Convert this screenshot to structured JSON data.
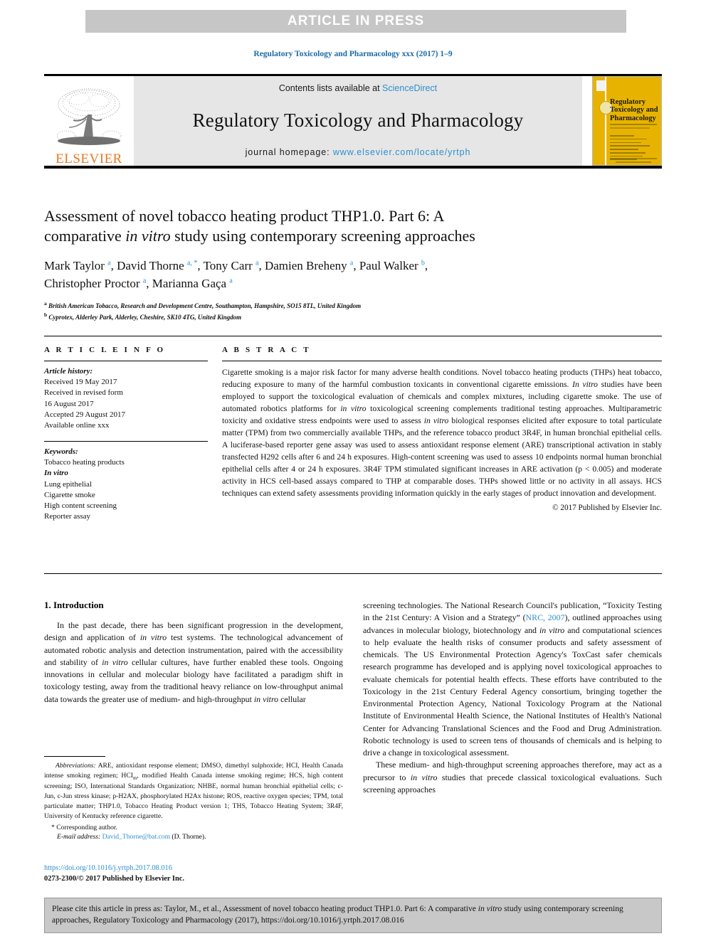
{
  "banner": {
    "text": "ARTICLE IN PRESS",
    "band_color": "#c6c6c6"
  },
  "running_head": "Regulatory Toxicology and Pharmacology xxx (2017) 1–9",
  "masthead": {
    "contents_prefix": "Contents lists available at ",
    "sciencedirect": "ScienceDirect",
    "journal_title": "Regulatory Toxicology and Pharmacology",
    "homepage_label": "journal homepage: ",
    "homepage_url": "www.elsevier.com/locate/yrtph",
    "publisher_wordmark": "ELSEVIER",
    "publisher_color": "#e87722",
    "link_color": "#2e8ece",
    "cover": {
      "title": "Regulatory Toxicology and Pharmacology",
      "background_color": "#e8b300"
    }
  },
  "article": {
    "title_line1": "Assessment of novel tobacco heating product THP1.0. Part 6: A",
    "title_line2_pre": "comparative ",
    "title_line2_em": "in vitro",
    "title_line2_post": " study using contemporary screening approaches",
    "authors": [
      {
        "name": "Mark Taylor",
        "marks": "a"
      },
      {
        "name": "David Thorne",
        "marks": "a, *"
      },
      {
        "name": "Tony Carr",
        "marks": "a"
      },
      {
        "name": "Damien Breheny",
        "marks": "a"
      },
      {
        "name": "Paul Walker",
        "marks": "b"
      },
      {
        "name": "Christopher Proctor",
        "marks": "a"
      },
      {
        "name": "Marianna Gaça",
        "marks": "a"
      }
    ],
    "affiliations": [
      {
        "mark": "a",
        "text": "British American Tobacco, Research and Development Centre, Southampton, Hampshire, SO15 8TL, United Kingdom"
      },
      {
        "mark": "b",
        "text": "Cyprotex, Alderley Park, Alderley, Cheshire, SK10 4TG, United Kingdom"
      }
    ]
  },
  "article_info": {
    "heading": "A R T I C L E   I N F O",
    "history_label": "Article history:",
    "history_lines": [
      "Received 19 May 2017",
      "Received in revised form",
      "16 August 2017",
      "Accepted 29 August 2017",
      "Available online xxx"
    ],
    "keywords_label": "Keywords:",
    "keywords": [
      "Tobacco heating products",
      "In vitro",
      "Lung epithelial",
      "Cigarette smoke",
      "High content screening",
      "Reporter assay"
    ],
    "keywords_italic_index": 1
  },
  "abstract": {
    "heading": "A B S T R A C T",
    "parts": [
      {
        "t": "Cigarette smoking is a major risk factor for many adverse health conditions. Novel tobacco heating products (THPs) heat tobacco, reducing exposure to many of the harmful combustion toxicants in conventional cigarette emissions. "
      },
      {
        "t": "In vitro",
        "em": true
      },
      {
        "t": " studies have been employed to support the toxicological evaluation of chemicals and complex mixtures, including cigarette smoke. The use of automated robotics platforms for "
      },
      {
        "t": "in vitro",
        "em": true
      },
      {
        "t": " toxicological screening complements traditional testing approaches. Multiparametric toxicity and oxidative stress endpoints were used to assess "
      },
      {
        "t": "in vitro",
        "em": true
      },
      {
        "t": " biological responses elicited after exposure to total particulate matter (TPM) from two commercially available THPs, and the reference tobacco product 3R4F, in human bronchial epithelial cells. A luciferase-based reporter gene assay was used to assess antioxidant response element (ARE) transcriptional activation in stably transfected H292 cells after 6 and 24 h exposures. High-content screening was used to assess 10 endpoints normal human bronchial epithelial cells after 4 or 24 h exposures. 3R4F TPM stimulated significant increases in ARE activation (p < 0.005) and moderate activity in HCS cell-based assays compared to THP at comparable doses. THPs showed little or no activity in all assays. HCS techniques can extend safety assessments providing information quickly in the early stages of product innovation and development."
      }
    ],
    "copyright": "© 2017 Published by Elsevier Inc."
  },
  "introduction": {
    "heading": "1. Introduction",
    "left_paragraph_parts": [
      {
        "t": "In the past decade, there has been significant progression in the development, design and application of "
      },
      {
        "t": "in vitro",
        "em": true
      },
      {
        "t": " test systems. The technological advancement of automated robotic analysis and detection instrumentation, paired with the accessibility and stability of "
      },
      {
        "t": "in vitro",
        "em": true
      },
      {
        "t": " cellular cultures, have further enabled these tools. Ongoing innovations in cellular and molecular biology have facilitated a paradigm shift in toxicology testing, away from the traditional heavy reliance on low-throughput animal data towards the greater use of medium- and high-throughput "
      },
      {
        "t": "in vitro",
        "em": true
      },
      {
        "t": " cellular"
      }
    ],
    "right_paragraph1_parts": [
      {
        "t": "screening technologies. The National Research Council's publication, “Toxicity Testing in the 21st Century: A Vision and a Strategy” ("
      },
      {
        "t": "NRC, 2007",
        "link": true
      },
      {
        "t": "), outlined approaches using advances in molecular biology, biotechnology and "
      },
      {
        "t": "in vitro",
        "em": true
      },
      {
        "t": " and computational sciences to help evaluate the health risks of consumer products and safety assessment of chemicals. The US Environmental Protection Agency's ToxCast safer chemicals research programme has developed and is applying novel toxicological approaches to evaluate chemicals for potential health effects. These efforts have contributed to the Toxicology in the 21st Century Federal Agency consortium, bringing together the Environmental Protection Agency, National Toxicology Program at the National Institute of Environmental Health Science, the National Institutes of Health's National Center for Advancing Translational Sciences and the Food and Drug Administration. Robotic technology is used to screen tens of thousands of chemicals and is helping to drive a change in toxicological assessment."
      }
    ],
    "right_paragraph2_parts": [
      {
        "t": "These medium- and high-throughput screening approaches therefore, may act as a precursor to "
      },
      {
        "t": "in vitro",
        "em": true
      },
      {
        "t": " studies that precede classical toxicological evaluations. Such screening approaches"
      }
    ]
  },
  "footnotes": {
    "abbreviations_label": "Abbreviations:",
    "abbreviations_text": " ARE, antioxidant response element; DMSO, dimethyl sulphoxide; HCI, Health Canada intense smoking regimen; HCI",
    "abbreviations_sub": "m",
    "abbreviations_text2": ", modified Health Canada intense smoking regime; HCS, high content screening; ISO, International Standards Organization; NHBE, normal human bronchial epithelial cells; c-Jun, c-Jun stress kinase; p-H2AX, phosphorylated H2Ax histone; ROS, reactive oxygen species; TPM, total particulate matter; THP1.0, Tobacco Heating Product version 1; THS, Tobacco Heating System; 3R4F, University of Kentucky reference cigarette.",
    "corresponding": "* Corresponding author.",
    "email_label": "E-mail address:",
    "email": "David_Thorne@bat.com",
    "email_suffix": " (D. Thorne)."
  },
  "doi_block": {
    "doi_url": "https://doi.org/10.1016/j.yrtph.2017.08.016",
    "issn_line": "0273-2300/© 2017 Published by Elsevier Inc."
  },
  "cite_box": {
    "parts": [
      {
        "t": "Please cite this article in press as: Taylor, M., et al., Assessment of novel tobacco heating product THP1.0. Part 6: A comparative "
      },
      {
        "t": "in vitro",
        "em": true
      },
      {
        "t": " study using contemporary screening approaches, Regulatory Toxicology and Pharmacology (2017), https://doi.org/10.1016/j.yrtph.2017.08.016"
      }
    ],
    "background_color": "#c8c8c8"
  }
}
